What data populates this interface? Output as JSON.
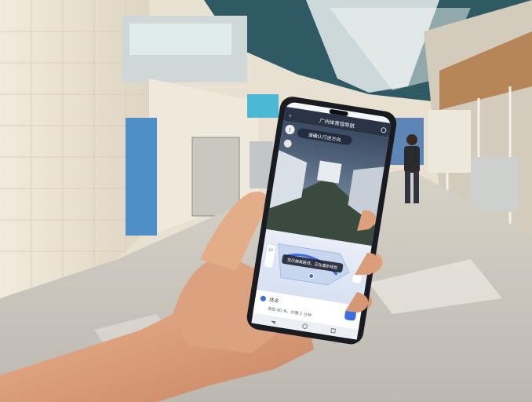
{
  "photo": {
    "subject": "hand-holding-smartphone-in-indoor-corridor"
  },
  "phone": {
    "app_title": "广州体育馆导航",
    "ar_banner": "请确认行进方向",
    "route_hint": "您已偏离路线，正在重新规划",
    "destination_label": "终点",
    "destination_detail": "距您 80 米，约需 2 分钟",
    "floor_label": "1F",
    "nav_bar_icons": [
      "back-icon",
      "home-icon",
      "recents-icon"
    ]
  },
  "colors": {
    "wall": "#efe7d4",
    "floor": "#cbc7bd",
    "ceiling_tent": "#2f5a63",
    "phone_body": "#1a1b20",
    "map_blue": "#7f9fd6"
  }
}
